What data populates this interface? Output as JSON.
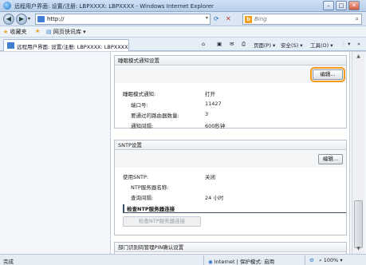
{
  "window": {
    "title": "远程用户界面: 设置/注册: LBPXXXX: LBPXXXX - Windows Internet Explorer",
    "min_label": "–",
    "max_label": "□",
    "close_label": "✕"
  },
  "address_bar": {
    "back_label": "◀",
    "forward_label": "▶",
    "url": "http://",
    "dropdown": "▾",
    "refresh": "⟳",
    "stop": "✕",
    "search_provider_logo": "b",
    "search_placeholder": "Bing",
    "search_icon": "⌕"
  },
  "favorites_bar": {
    "favorites_label": "收藏夹",
    "web_slice_gallery_label": "网页快讯库",
    "web_slice_dropdown": "▾"
  },
  "tab": {
    "label": "远程用户界面: 设置/注册: LBPXXXX: LBPXXXX"
  },
  "command_bar": {
    "home": "⌂",
    "feeds": "▣",
    "mail": "✉",
    "print": "⎙",
    "page_label": "页面(P) ▾",
    "safety_label": "安全(S) ▾",
    "tools_label": "工具(O) ▾",
    "help_label": "❔ ▾",
    "more": "»"
  },
  "sleep_notification": {
    "title": "睡眠模式通知设置",
    "edit_button": "编辑...",
    "rows": [
      {
        "label": "睡眠模式通知:",
        "value": "打开"
      },
      {
        "label": "端口号:",
        "value": "11427"
      },
      {
        "label": "要通过的路由器数量:",
        "value": "3"
      },
      {
        "label": "通知间隔:",
        "value": "600秒钟"
      }
    ]
  },
  "sntp": {
    "title": "SNTP设置",
    "edit_button": "编辑...",
    "rows": [
      {
        "label": "使用SNTP:",
        "value": "关闭"
      },
      {
        "label": "NTP服务器名称:",
        "value": ""
      },
      {
        "label": "查询间隔:",
        "value": "24 小时"
      }
    ],
    "check_heading": "检查NTP服务器连接",
    "check_button": "检查NTP服务器连接"
  },
  "dept_id": {
    "title": "部门识别码管理PIN确认设置"
  },
  "status_bar": {
    "left": "完成",
    "zone": "Internet | 保护模式: 启用",
    "zoom": "100%",
    "zoom_dropdown": "▾"
  },
  "scrollbar": {
    "up": "▲",
    "down": "▼"
  }
}
